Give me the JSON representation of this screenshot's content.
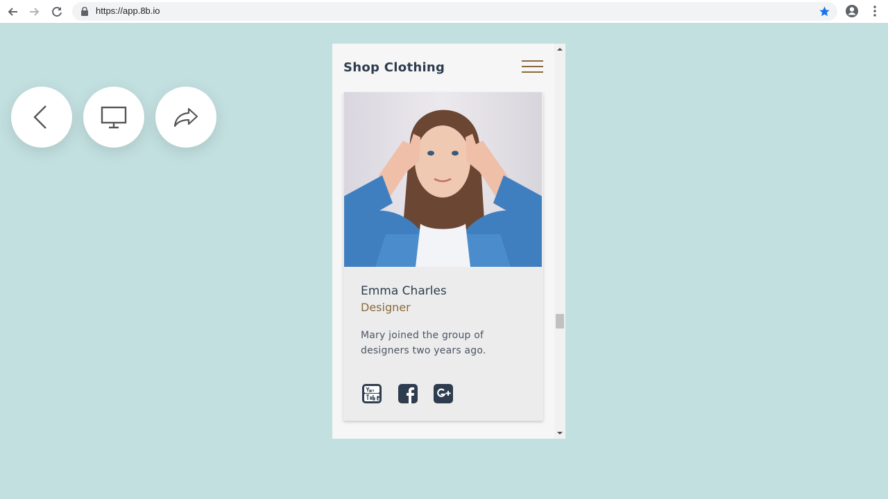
{
  "browser": {
    "url": "https://app.8b.io"
  },
  "app": {
    "title": "Shop Clothing"
  },
  "profile_card": {
    "name": "Emma Charles",
    "role": "Designer",
    "bio": "Mary joined the group of designers two years ago.",
    "social_icons": [
      "youtube-icon",
      "facebook-icon",
      "google-plus-icon"
    ]
  },
  "floating_controls": [
    "back-icon",
    "desktop-icon",
    "share-icon"
  ],
  "colors": {
    "page_background": "#c3e0e0",
    "accent": "#8a6a3c",
    "text_dark": "#2e3c4f",
    "card_background": "#ececec",
    "star": "#1a73e8"
  }
}
